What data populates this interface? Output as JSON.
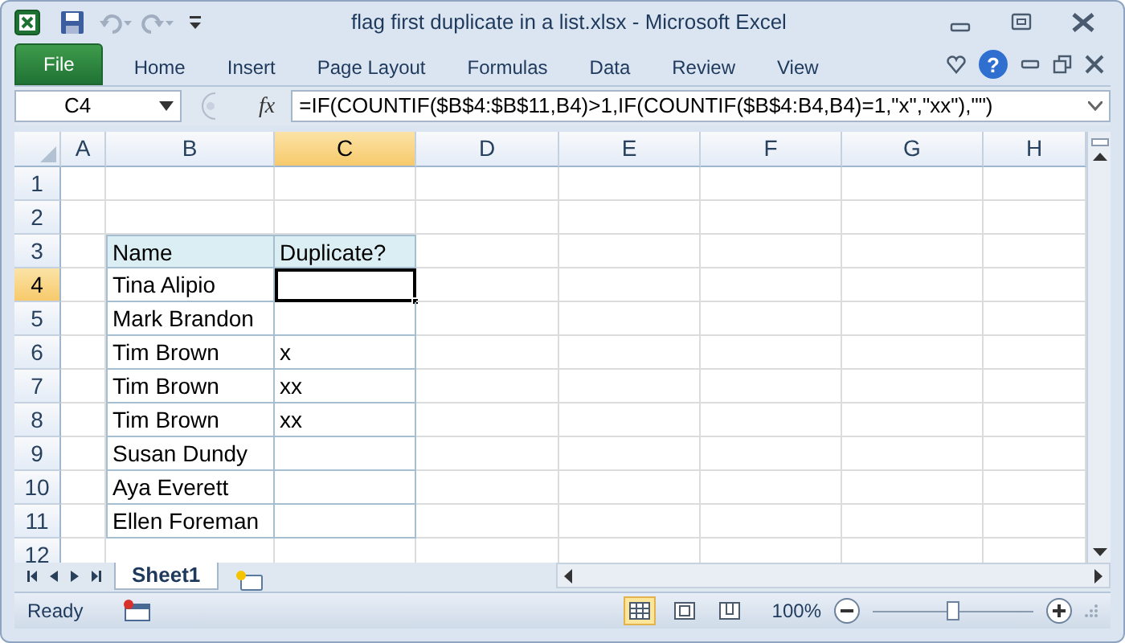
{
  "window": {
    "title": "flag first duplicate in a list.xlsx  -  Microsoft Excel"
  },
  "ribbon_tabs": [
    {
      "label": "File",
      "kind": "file",
      "selected": false
    },
    {
      "label": "Home",
      "kind": "tab",
      "selected": false
    },
    {
      "label": "Insert",
      "kind": "tab",
      "selected": false
    },
    {
      "label": "Page Layout",
      "kind": "tab",
      "selected": false
    },
    {
      "label": "Formulas",
      "kind": "tab",
      "selected": false
    },
    {
      "label": "Data",
      "kind": "tab",
      "selected": false
    },
    {
      "label": "Review",
      "kind": "tab",
      "selected": false
    },
    {
      "label": "View",
      "kind": "tab",
      "selected": false
    }
  ],
  "help_button": "?",
  "formula_bar": {
    "name_box": "C4",
    "function_button": "fx",
    "formula": "=IF(COUNTIF($B$4:$B$11,B4)>1,IF(COUNTIF($B$4:B4,B4)=1,\"x\",\"xx\"),\"\")"
  },
  "columns": [
    {
      "label": "A",
      "selected": false
    },
    {
      "label": "B",
      "selected": false
    },
    {
      "label": "C",
      "selected": true
    },
    {
      "label": "D",
      "selected": false
    },
    {
      "label": "E",
      "selected": false
    },
    {
      "label": "F",
      "selected": false
    },
    {
      "label": "G",
      "selected": false
    },
    {
      "label": "H",
      "selected": false
    }
  ],
  "rows": [
    {
      "label": "1",
      "selected": false
    },
    {
      "label": "2",
      "selected": false
    },
    {
      "label": "3",
      "selected": false
    },
    {
      "label": "4",
      "selected": true
    },
    {
      "label": "5",
      "selected": false
    },
    {
      "label": "6",
      "selected": false
    },
    {
      "label": "7",
      "selected": false
    },
    {
      "label": "8",
      "selected": false
    },
    {
      "label": "9",
      "selected": false
    },
    {
      "label": "10",
      "selected": false
    },
    {
      "label": "11",
      "selected": false
    },
    {
      "label": "12",
      "selected": false
    }
  ],
  "table": {
    "header": [
      "Name",
      "Duplicate?"
    ],
    "rows": [
      {
        "name": "Tina Alipio",
        "selected": true
      },
      {
        "name": "Mark Brandon",
        "selected": false
      },
      {
        "name": "Tim Brown",
        "duplicate": "x",
        "selected": false
      },
      {
        "name": "Tim Brown",
        "duplicate": "xx",
        "selected": false
      },
      {
        "name": "Tim Brown",
        "duplicate": "xx",
        "selected": false
      },
      {
        "name": "Susan Dundy",
        "selected": false
      },
      {
        "name": "Aya Everett",
        "selected": false
      },
      {
        "name": "Ellen Foreman",
        "selected": false
      }
    ]
  },
  "sheet_tabs": [
    {
      "label": "Sheet1",
      "selected": true
    }
  ],
  "status_bar": {
    "status": "Ready",
    "view_buttons": [
      {
        "kind": "normal",
        "selected": true
      },
      {
        "kind": "page_layout",
        "selected": false
      },
      {
        "kind": "page_break",
        "selected": false
      }
    ],
    "zoom": "100%",
    "zoom_slider": {
      "level": 0.5
    }
  }
}
